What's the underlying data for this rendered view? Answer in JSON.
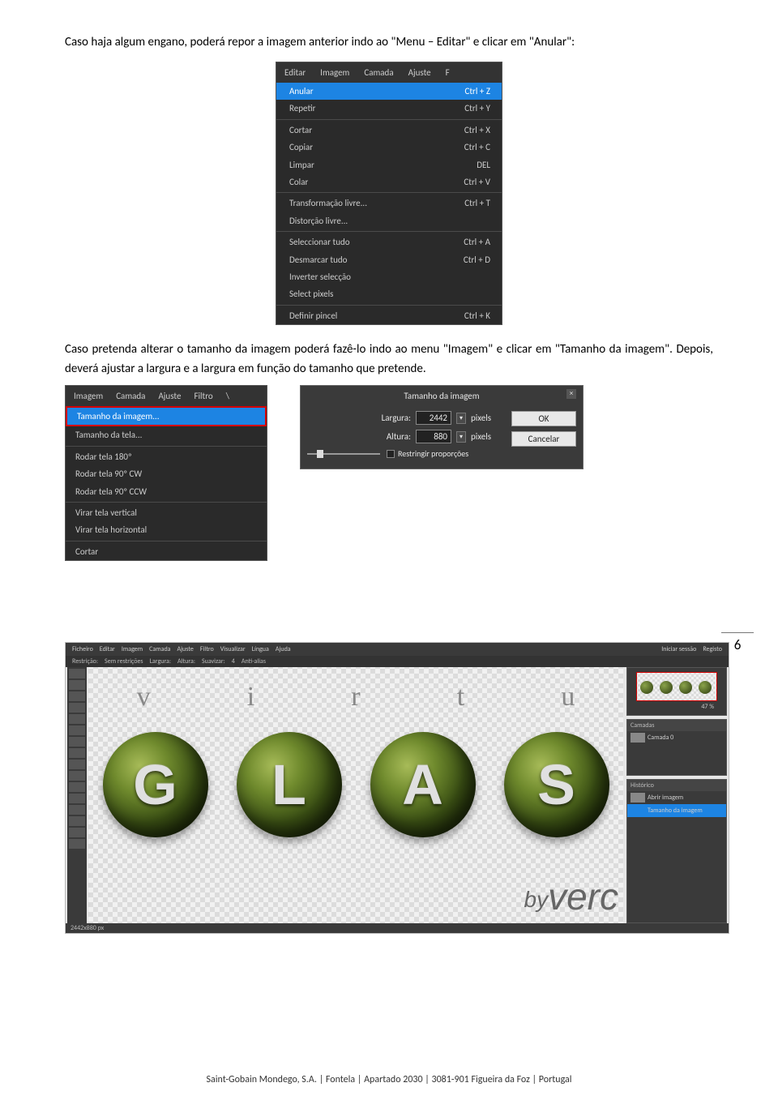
{
  "paragraphs": {
    "p1": "Caso haja algum engano, poderá repor a imagem anterior indo ao \"Menu – Editar\" e clicar em \"Anular\":",
    "p2": "Caso pretenda alterar o tamanho da imagem poderá fazê-lo indo ao menu \"Imagem\" e clicar em \"Tamanho da imagem\". Depois, deverá ajustar a largura e a largura em função do tamanho que pretende."
  },
  "editar_menu": {
    "bar": [
      "Editar",
      "Imagem",
      "Camada",
      "Ajuste",
      "F"
    ],
    "items": [
      {
        "label": "Anular",
        "shortcut": "Ctrl + Z",
        "highlight": true
      },
      {
        "label": "Repetir",
        "shortcut": "Ctrl + Y"
      },
      {
        "sep": true
      },
      {
        "label": "Cortar",
        "shortcut": "Ctrl + X"
      },
      {
        "label": "Copiar",
        "shortcut": "Ctrl + C"
      },
      {
        "label": "Limpar",
        "shortcut": "DEL"
      },
      {
        "label": "Colar",
        "shortcut": "Ctrl + V"
      },
      {
        "sep": true
      },
      {
        "label": "Transformação livre...",
        "shortcut": "Ctrl + T"
      },
      {
        "label": "Distorção livre...",
        "shortcut": ""
      },
      {
        "sep": true
      },
      {
        "label": "Seleccionar tudo",
        "shortcut": "Ctrl + A"
      },
      {
        "label": "Desmarcar tudo",
        "shortcut": "Ctrl + D"
      },
      {
        "label": "Inverter selecção",
        "shortcut": ""
      },
      {
        "label": "Select pixels",
        "shortcut": ""
      },
      {
        "sep": true
      },
      {
        "label": "Definir pincel",
        "shortcut": "Ctrl + K"
      }
    ]
  },
  "imagem_menu": {
    "bar": [
      "Imagem",
      "Camada",
      "Ajuste",
      "Filtro",
      "\\"
    ],
    "items": [
      {
        "label": "Tamanho da imagem...",
        "highlight": true,
        "redbox": true
      },
      {
        "label": "Tamanho da tela...",
        "shortcut": ""
      },
      {
        "sep": true
      },
      {
        "label": "Rodar tela 180º"
      },
      {
        "label": "Rodar tela 90º CW"
      },
      {
        "label": "Rodar tela 90º CCW"
      },
      {
        "sep": true
      },
      {
        "label": "Virar tela vertical"
      },
      {
        "label": "Virar tela horizontal"
      },
      {
        "sep": true
      },
      {
        "label": "Cortar"
      }
    ]
  },
  "dialog": {
    "title": "Tamanho da imagem",
    "close": "×",
    "largura_label": "Largura:",
    "largura_value": "2442",
    "altura_label": "Altura:",
    "altura_value": "880",
    "unit": "pixels",
    "restrict": "Restringir proporções",
    "ok": "OK",
    "cancel": "Cancelar"
  },
  "page_number": "6",
  "editor": {
    "menus": [
      "Ficheiro",
      "Editar",
      "Imagem",
      "Camada",
      "Ajuste",
      "Filtro",
      "Visualizar",
      "Língua",
      "Ajuda"
    ],
    "right_links": [
      "Iniciar sessão",
      "Registo"
    ],
    "subbar": [
      "Restrição:",
      "Sem restrições",
      "Largura:",
      "Altura:",
      "Suavizar:",
      "4",
      "Anti-alias"
    ],
    "right_panels": {
      "nav_zoom": "47 %",
      "layers_title": "Camadas",
      "layer_name": "Camada 0",
      "hist_title": "Histórico",
      "hist_items": [
        "Abrir imagem",
        "Tamanho da imagem"
      ]
    },
    "status": "2442x880 px",
    "top_letters": [
      "v",
      "i",
      "r",
      "t",
      "u"
    ],
    "orb_letters": [
      "G",
      "L",
      "A",
      "S"
    ],
    "logo_by": "by",
    "logo_word": "verc"
  },
  "footer": "Saint-Gobain Mondego, S.A. | Fontela | Apartado 2030 | 3081-901 Figueira da Foz | Portugal"
}
